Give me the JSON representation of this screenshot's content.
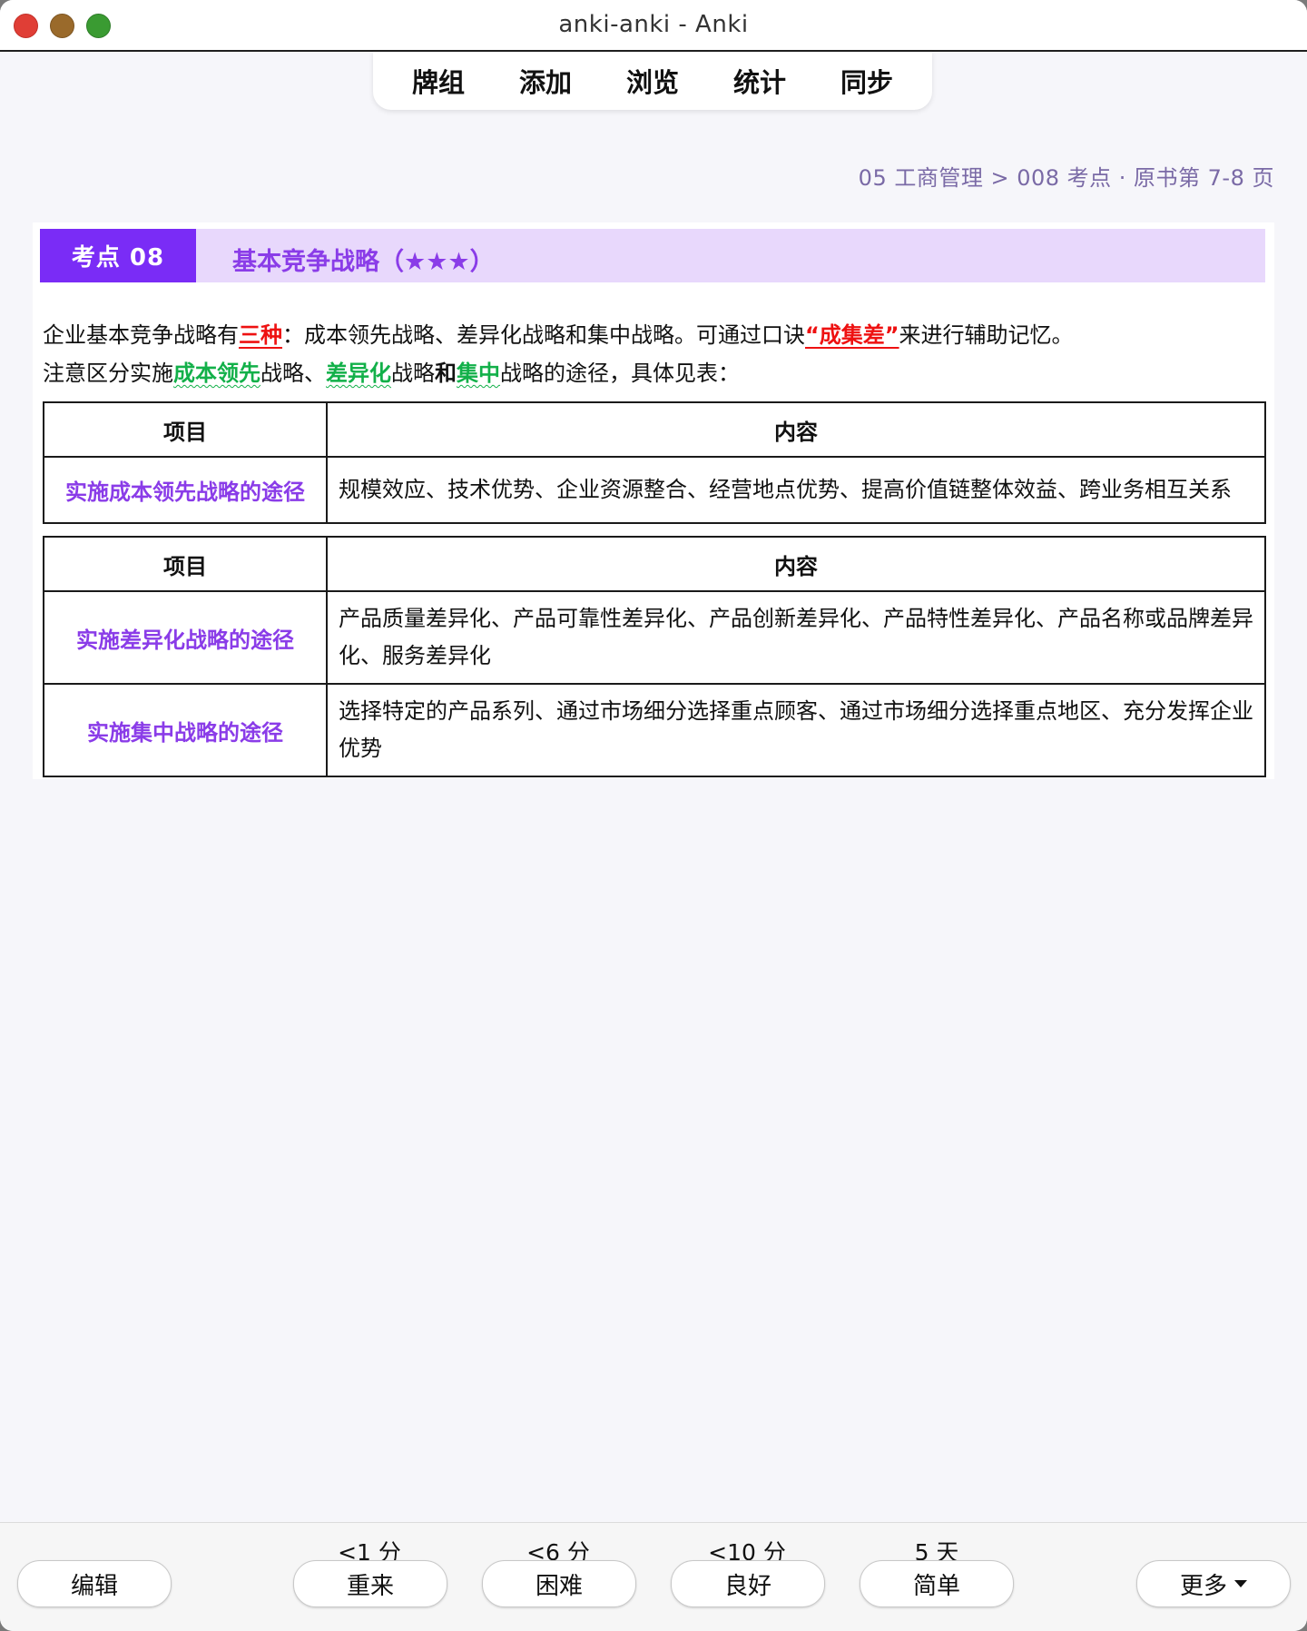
{
  "window": {
    "title": "anki-anki - Anki"
  },
  "nav": {
    "items": [
      "牌组",
      "添加",
      "浏览",
      "统计",
      "同步"
    ]
  },
  "breadcrumb": "05 工商管理 > 008 考点 · 原书第 7-8 页",
  "topic": {
    "badge": "考点 08",
    "title": "基本竞争战略（★★★）"
  },
  "paragraph1": {
    "pre": "企业基本竞争战略有",
    "highlight1": "三种",
    "mid": "：成本领先战略、差异化战略和集中战略。可通过口诀",
    "highlight2": "“成集差”",
    "post": "来进行辅助记忆。"
  },
  "paragraph2": {
    "pre": "注意区分实施",
    "g1": "成本领先",
    "s1": "战略、",
    "g2": "差异化",
    "s2": "战略",
    "b1": "和",
    "g3": "集中",
    "post": "战略的途径，具体见表："
  },
  "table1": {
    "headers": [
      "项目",
      "内容"
    ],
    "rows": [
      {
        "item": "实施成本领先战略的途径",
        "content": "规模效应、技术优势、企业资源整合、经营地点优势、提高价值链整体效益、跨业务相互关系"
      }
    ]
  },
  "table2": {
    "headers": [
      "项目",
      "内容"
    ],
    "rows": [
      {
        "item": "实施差异化战略的途径",
        "content": "产品质量差异化、产品可靠性差异化、产品创新差异化、产品特性差异化、产品名称或品牌差异化、服务差异化"
      },
      {
        "item": "实施集中战略的途径",
        "content": "选择特定的产品系列、通过市场细分选择重点顾客、通过市场细分选择重点地区、充分发挥企业优势"
      }
    ]
  },
  "bottom": {
    "edit_label": "编辑",
    "more_label": "更多",
    "answers": [
      {
        "interval": "<1 分",
        "label": "重来"
      },
      {
        "interval": "<6 分",
        "label": "困难"
      },
      {
        "interval": "<10 分",
        "label": "良好"
      },
      {
        "interval": "5 天",
        "label": "简单"
      }
    ]
  }
}
